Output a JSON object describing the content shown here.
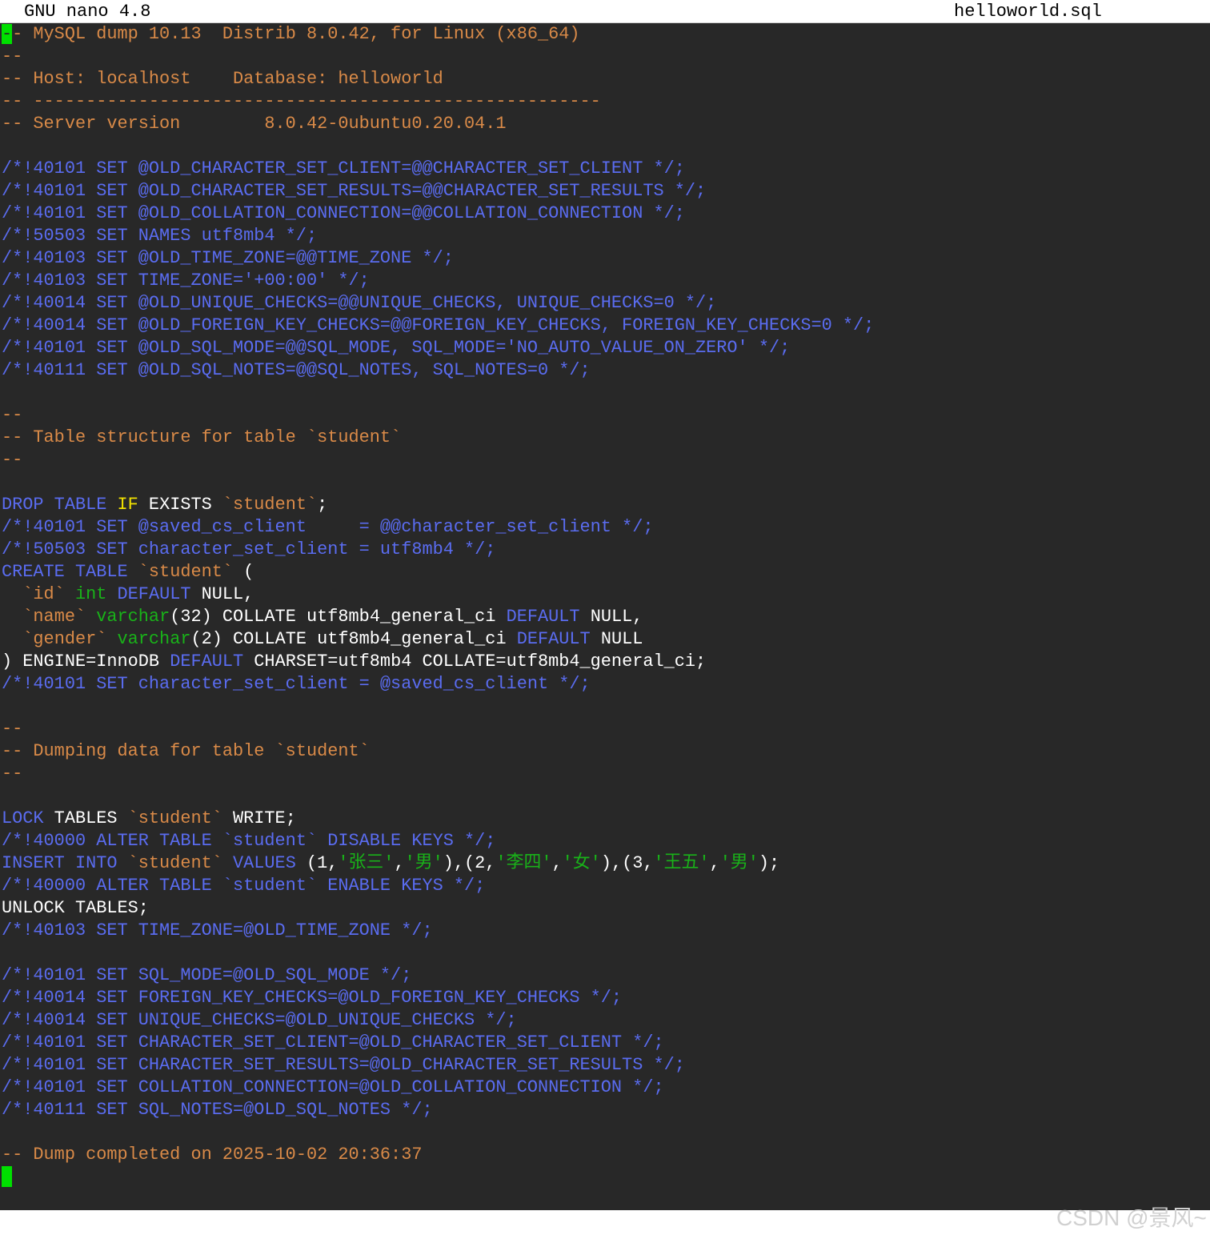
{
  "titlebar": {
    "app": "GNU nano 4.8",
    "filename": "helloworld.sql"
  },
  "colors": {
    "background": "#282828",
    "comment": "#d98a48",
    "keyword": "#5a6cf0",
    "type": "#19b219",
    "if": "#f0e000",
    "string_cn": "#19b219",
    "text": "#ffffff",
    "cursor": "#00e000"
  },
  "editor": {
    "lines": [
      [
        {
          "t": "-",
          "c": "cursor"
        },
        {
          "t": "- MySQL dump 10.13  Distrib 8.0.42, for Linux (x86_64)",
          "c": "comment"
        }
      ],
      [
        {
          "t": "--",
          "c": "comment"
        }
      ],
      [
        {
          "t": "-- Host: localhost    Database: helloworld",
          "c": "comment"
        }
      ],
      [
        {
          "t": "-- ------------------------------------------------------",
          "c": "comment"
        }
      ],
      [
        {
          "t": "-- Server version\t8.0.42-0ubuntu0.20.04.1",
          "c": "comment"
        }
      ],
      [],
      [
        {
          "t": "/*!40101 SET @OLD_CHARACTER_SET_CLIENT=@@CHARACTER_SET_CLIENT */;",
          "c": "keyword"
        }
      ],
      [
        {
          "t": "/*!40101 SET @OLD_CHARACTER_SET_RESULTS=@@CHARACTER_SET_RESULTS */;",
          "c": "keyword"
        }
      ],
      [
        {
          "t": "/*!40101 SET @OLD_COLLATION_CONNECTION=@@COLLATION_CONNECTION */;",
          "c": "keyword"
        }
      ],
      [
        {
          "t": "/*!50503 SET NAMES utf8mb4 */;",
          "c": "keyword"
        }
      ],
      [
        {
          "t": "/*!40103 SET @OLD_TIME_ZONE=@@TIME_ZONE */;",
          "c": "keyword"
        }
      ],
      [
        {
          "t": "/*!40103 SET TIME_ZONE='+00:00' */;",
          "c": "keyword"
        }
      ],
      [
        {
          "t": "/*!40014 SET @OLD_UNIQUE_CHECKS=@@UNIQUE_CHECKS, UNIQUE_CHECKS=0 */;",
          "c": "keyword"
        }
      ],
      [
        {
          "t": "/*!40014 SET @OLD_FOREIGN_KEY_CHECKS=@@FOREIGN_KEY_CHECKS, FOREIGN_KEY_CHECKS=0 */;",
          "c": "keyword"
        }
      ],
      [
        {
          "t": "/*!40101 SET @OLD_SQL_MODE=@@SQL_MODE, SQL_MODE='NO_AUTO_VALUE_ON_ZERO' */;",
          "c": "keyword"
        }
      ],
      [
        {
          "t": "/*!40111 SET @OLD_SQL_NOTES=@@SQL_NOTES, SQL_NOTES=0 */;",
          "c": "keyword"
        }
      ],
      [],
      [
        {
          "t": "--",
          "c": "comment"
        }
      ],
      [
        {
          "t": "-- Table structure for table `student`",
          "c": "comment"
        }
      ],
      [
        {
          "t": "--",
          "c": "comment"
        }
      ],
      [],
      [
        {
          "t": "DROP TABLE ",
          "c": "keyword"
        },
        {
          "t": "IF",
          "c": "if"
        },
        {
          "t": " EXISTS ",
          "c": "text"
        },
        {
          "t": "`student`",
          "c": "comment"
        },
        {
          "t": ";",
          "c": "text"
        }
      ],
      [
        {
          "t": "/*!40101 SET @saved_cs_client     = @@character_set_client */;",
          "c": "keyword"
        }
      ],
      [
        {
          "t": "/*!50503 SET character_set_client = utf8mb4 */;",
          "c": "keyword"
        }
      ],
      [
        {
          "t": "CREATE TABLE ",
          "c": "keyword"
        },
        {
          "t": "`student`",
          "c": "comment"
        },
        {
          "t": " (",
          "c": "text"
        }
      ],
      [
        {
          "t": "  ",
          "c": "text"
        },
        {
          "t": "`id`",
          "c": "comment"
        },
        {
          "t": " ",
          "c": "text"
        },
        {
          "t": "int",
          "c": "type"
        },
        {
          "t": " ",
          "c": "text"
        },
        {
          "t": "DEFAULT",
          "c": "keyword"
        },
        {
          "t": " NULL,",
          "c": "text"
        }
      ],
      [
        {
          "t": "  ",
          "c": "text"
        },
        {
          "t": "`name`",
          "c": "comment"
        },
        {
          "t": " ",
          "c": "text"
        },
        {
          "t": "varchar",
          "c": "type"
        },
        {
          "t": "(32) COLLATE utf8mb4_general_ci ",
          "c": "text"
        },
        {
          "t": "DEFAULT",
          "c": "keyword"
        },
        {
          "t": " NULL,",
          "c": "text"
        }
      ],
      [
        {
          "t": "  ",
          "c": "text"
        },
        {
          "t": "`gender`",
          "c": "comment"
        },
        {
          "t": " ",
          "c": "text"
        },
        {
          "t": "varchar",
          "c": "type"
        },
        {
          "t": "(2) COLLATE utf8mb4_general_ci ",
          "c": "text"
        },
        {
          "t": "DEFAULT",
          "c": "keyword"
        },
        {
          "t": " NULL",
          "c": "text"
        }
      ],
      [
        {
          "t": ") ENGINE=InnoDB ",
          "c": "text"
        },
        {
          "t": "DEFAULT",
          "c": "keyword"
        },
        {
          "t": " CHARSET=utf8mb4 COLLATE=utf8mb4_general_ci;",
          "c": "text"
        }
      ],
      [
        {
          "t": "/*!40101 SET character_set_client = @saved_cs_client */;",
          "c": "keyword"
        }
      ],
      [],
      [
        {
          "t": "--",
          "c": "comment"
        }
      ],
      [
        {
          "t": "-- Dumping data for table `student`",
          "c": "comment"
        }
      ],
      [
        {
          "t": "--",
          "c": "comment"
        }
      ],
      [],
      [
        {
          "t": "LOCK",
          "c": "keyword"
        },
        {
          "t": " TABLES ",
          "c": "text"
        },
        {
          "t": "`student`",
          "c": "comment"
        },
        {
          "t": " WRITE;",
          "c": "text"
        }
      ],
      [
        {
          "t": "/*!40000 ALTER TABLE `student` DISABLE KEYS */;",
          "c": "keyword"
        }
      ],
      [
        {
          "t": "INSERT INTO ",
          "c": "keyword"
        },
        {
          "t": "`student`",
          "c": "comment"
        },
        {
          "t": " ",
          "c": "text"
        },
        {
          "t": "VALUES",
          "c": "keyword"
        },
        {
          "t": " (1,",
          "c": "text"
        },
        {
          "t": "'张三'",
          "c": "string_cn"
        },
        {
          "t": ",",
          "c": "text"
        },
        {
          "t": "'男'",
          "c": "string_cn"
        },
        {
          "t": "),(2,",
          "c": "text"
        },
        {
          "t": "'李四'",
          "c": "string_cn"
        },
        {
          "t": ",",
          "c": "text"
        },
        {
          "t": "'女'",
          "c": "string_cn"
        },
        {
          "t": "),(3,",
          "c": "text"
        },
        {
          "t": "'王五'",
          "c": "string_cn"
        },
        {
          "t": ",",
          "c": "text"
        },
        {
          "t": "'男'",
          "c": "string_cn"
        },
        {
          "t": ");",
          "c": "text"
        }
      ],
      [
        {
          "t": "/*!40000 ALTER TABLE `student` ENABLE KEYS */;",
          "c": "keyword"
        }
      ],
      [
        {
          "t": "UNLOCK TABLES;",
          "c": "text"
        }
      ],
      [
        {
          "t": "/*!40103 SET TIME_ZONE=@OLD_TIME_ZONE */;",
          "c": "keyword"
        }
      ],
      [],
      [
        {
          "t": "/*!40101 SET SQL_MODE=@OLD_SQL_MODE */;",
          "c": "keyword"
        }
      ],
      [
        {
          "t": "/*!40014 SET FOREIGN_KEY_CHECKS=@OLD_FOREIGN_KEY_CHECKS */;",
          "c": "keyword"
        }
      ],
      [
        {
          "t": "/*!40014 SET UNIQUE_CHECKS=@OLD_UNIQUE_CHECKS */;",
          "c": "keyword"
        }
      ],
      [
        {
          "t": "/*!40101 SET CHARACTER_SET_CLIENT=@OLD_CHARACTER_SET_CLIENT */;",
          "c": "keyword"
        }
      ],
      [
        {
          "t": "/*!40101 SET CHARACTER_SET_RESULTS=@OLD_CHARACTER_SET_RESULTS */;",
          "c": "keyword"
        }
      ],
      [
        {
          "t": "/*!40101 SET COLLATION_CONNECTION=@OLD_COLLATION_CONNECTION */;",
          "c": "keyword"
        }
      ],
      [
        {
          "t": "/*!40111 SET SQL_NOTES=@OLD_SQL_NOTES */;",
          "c": "keyword"
        }
      ],
      [],
      [
        {
          "t": "-- Dump completed on 2025-10-02 20:36:37",
          "c": "comment"
        }
      ],
      [
        {
          "t": "",
          "c": "cursor-block"
        }
      ]
    ]
  },
  "watermark": "CSDN @景风~"
}
